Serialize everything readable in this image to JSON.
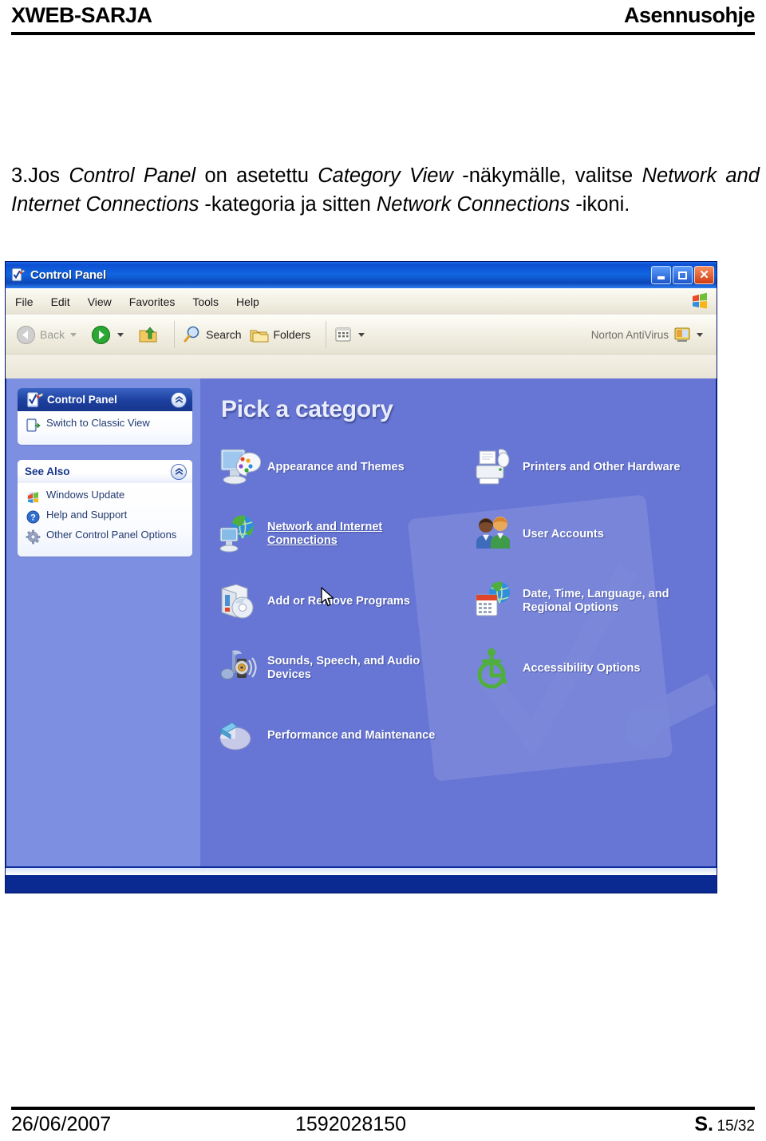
{
  "document": {
    "header": {
      "left": "XWEB-SARJA",
      "right": "Asennusohje"
    },
    "instruction": {
      "number": "3.",
      "seg1": "Jos ",
      "em1": "Control Panel",
      "seg2": " on asetettu ",
      "em2": "Category View",
      "seg3": " -näkymälle, valitse ",
      "em3": "Network and Internet Connections",
      "seg4": " -kategoria ja sitten ",
      "em4": "Network Connections",
      "seg5": " -ikoni."
    },
    "footer": {
      "date": "26/06/2007",
      "doc_number": "1592028150",
      "page_prefix": "S.",
      "page_value": "15/32"
    }
  },
  "window": {
    "title": "Control Panel",
    "title_icon": "control-panel-icon",
    "buttons": {
      "minimize": "Minimize",
      "maximize": "Maximize",
      "close": "Close"
    },
    "menu": [
      "File",
      "Edit",
      "View",
      "Favorites",
      "Tools",
      "Help"
    ],
    "toolbar": {
      "back": "Back",
      "forward": "",
      "up": "",
      "search": "Search",
      "folders": "Folders",
      "views": "",
      "norton": "Norton AntiVirus"
    }
  },
  "sidebar": {
    "panels": [
      {
        "title": "Control Panel",
        "icon": "control-panel-icon",
        "head_style": "blue",
        "chevron": "«",
        "links": [
          {
            "label": "Switch to Classic View",
            "icon": "switch-view-icon"
          }
        ]
      },
      {
        "title": "See Also",
        "icon": "",
        "head_style": "white",
        "chevron": "«",
        "links": [
          {
            "label": "Windows Update",
            "icon": "windows-update-icon"
          },
          {
            "label": "Help and Support",
            "icon": "help-support-icon"
          },
          {
            "label": "Other Control Panel Options",
            "icon": "gear-icon"
          }
        ]
      }
    ]
  },
  "main": {
    "heading": "Pick a category",
    "categories": [
      {
        "label": "Appearance and Themes",
        "icon": "appearance-themes-icon",
        "column": "left",
        "hovered": false
      },
      {
        "label": "Printers and Other Hardware",
        "icon": "printers-hardware-icon",
        "column": "right",
        "hovered": false
      },
      {
        "label": "Network and Internet Connections",
        "icon": "network-connections-icon",
        "column": "left",
        "hovered": true
      },
      {
        "label": "User Accounts",
        "icon": "user-accounts-icon",
        "column": "right",
        "hovered": false
      },
      {
        "label": "Add or Remove Programs",
        "icon": "add-remove-programs-icon",
        "column": "left",
        "hovered": false
      },
      {
        "label": "Date, Time, Language, and Regional Options",
        "icon": "date-time-regional-icon",
        "column": "right",
        "hovered": false
      },
      {
        "label": "Sounds, Speech, and Audio Devices",
        "icon": "sounds-audio-icon",
        "column": "left",
        "hovered": false
      },
      {
        "label": "Accessibility Options",
        "icon": "accessibility-icon",
        "column": "right",
        "hovered": false
      },
      {
        "label": "Performance and Maintenance",
        "icon": "performance-maintenance-icon",
        "column": "left",
        "hovered": false
      }
    ],
    "cursor": "mouse-pointer-icon"
  },
  "colors": {
    "titlebar_blue": "#0d4fd2",
    "main_pane": "#6776d4",
    "sidebar": "#7d8fe0",
    "panel_head_blue": "#1c3f9e",
    "accent_text": "#21396e"
  }
}
